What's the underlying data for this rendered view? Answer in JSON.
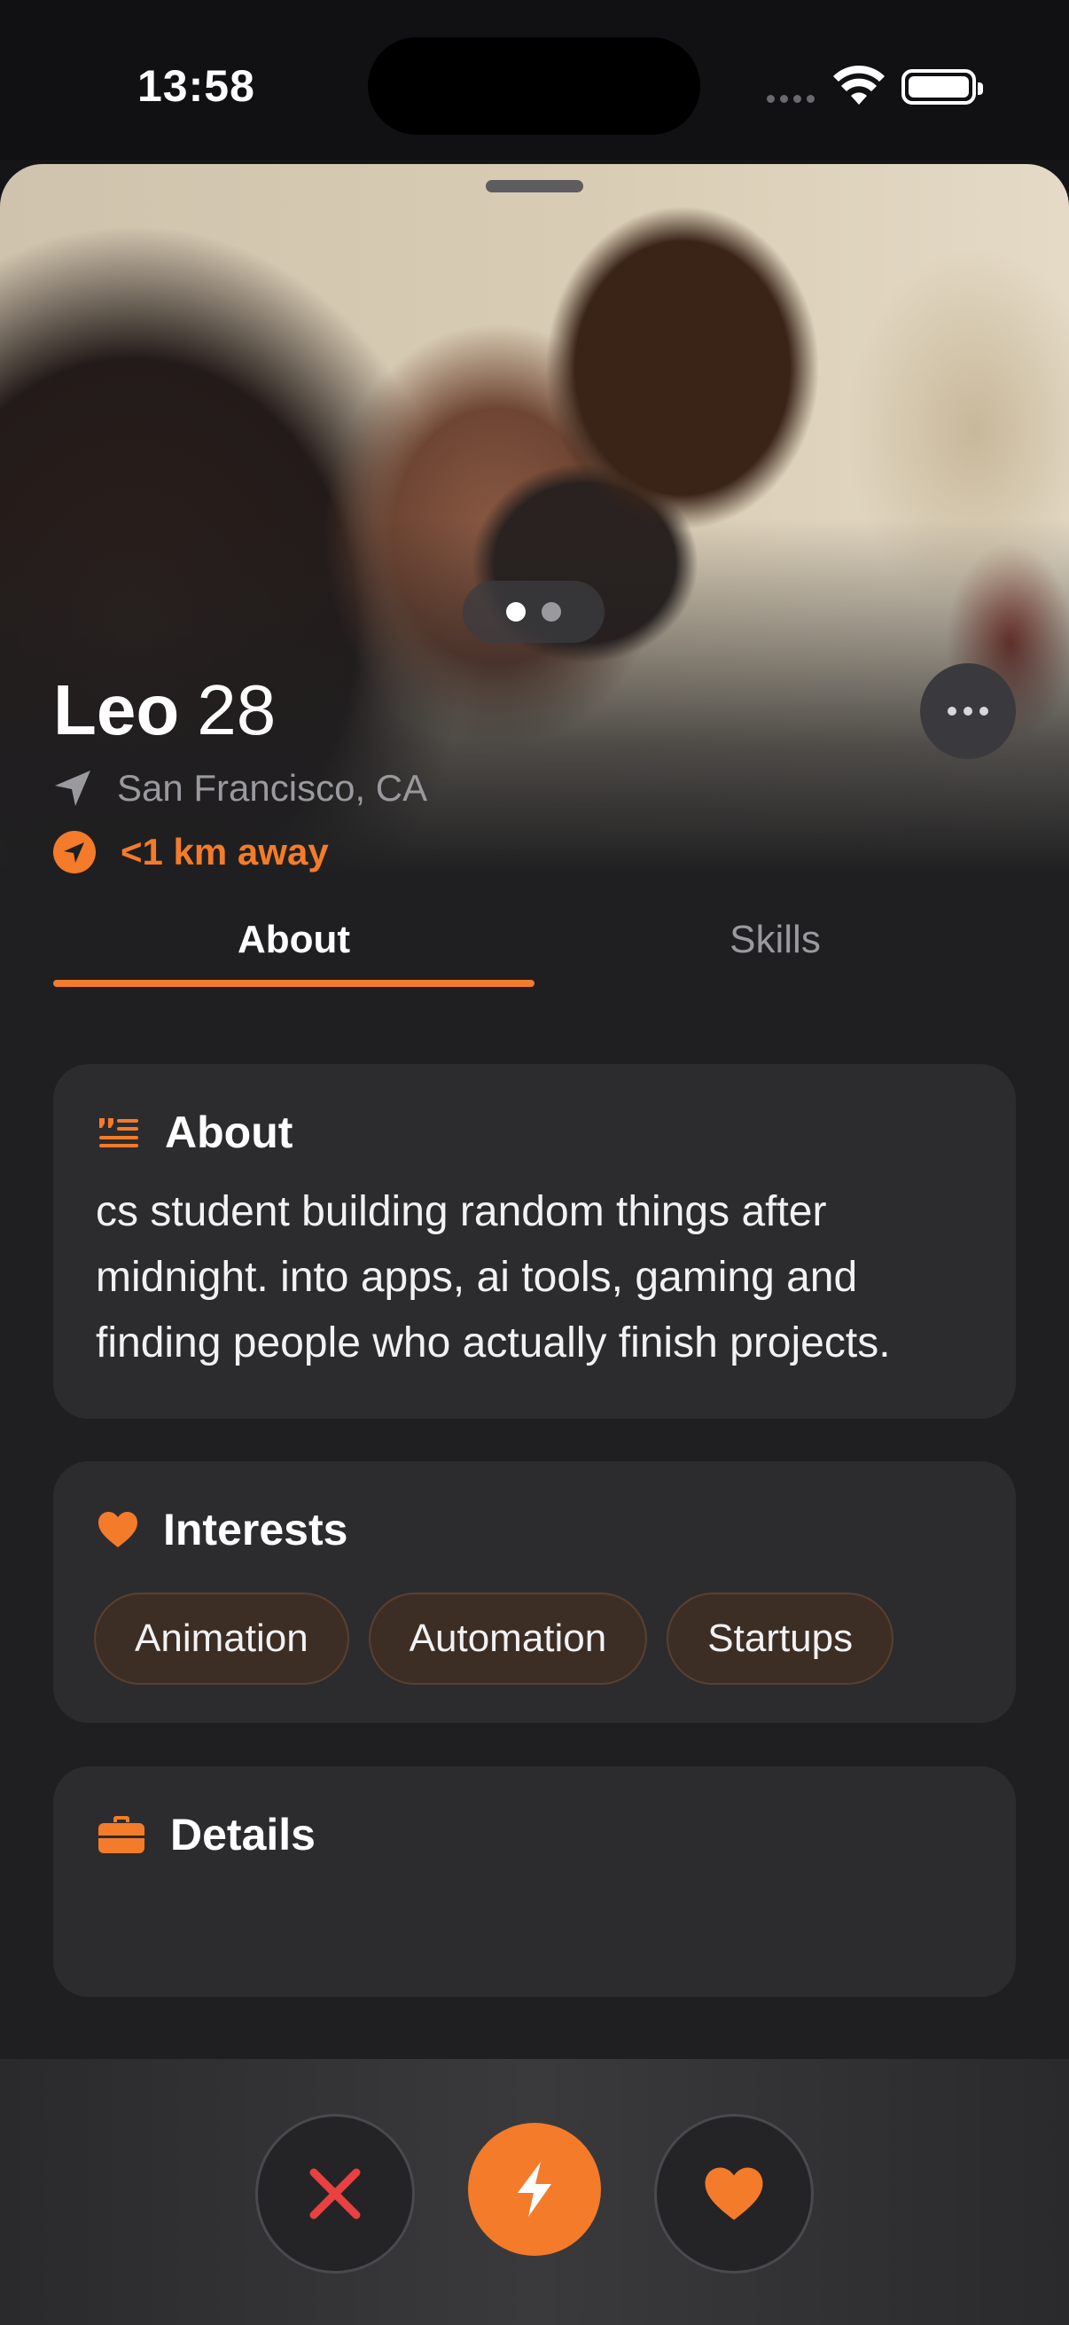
{
  "status_bar": {
    "time": "13:58"
  },
  "profile": {
    "name": "Leo",
    "age": "28",
    "location": "San Francisco, CA",
    "distance": "<1 km away",
    "photo_count": 2,
    "active_photo": 1
  },
  "tabs": [
    {
      "label": "About",
      "selected": true
    },
    {
      "label": "Skills",
      "selected": false
    }
  ],
  "about_card": {
    "title": "About",
    "text": "cs student building random things after midnight. into apps, ai tools, gaming and finding people who actually finish projects."
  },
  "interests_card": {
    "title": "Interests",
    "chips": [
      "Animation",
      "Automation",
      "Startups"
    ]
  },
  "details_card": {
    "title": "Details"
  },
  "colors": {
    "accent": "#f47b2a",
    "pass": "#e8413f",
    "background": "#1f1f21",
    "card": "#2c2c2e"
  },
  "icons": {
    "pass": "x-icon",
    "boost": "lightning-icon",
    "like": "heart-icon",
    "location": "location-arrow-icon",
    "distance": "navigation-circle-icon",
    "about": "quote-lines-icon",
    "interests": "heart-icon",
    "details": "briefcase-icon"
  }
}
